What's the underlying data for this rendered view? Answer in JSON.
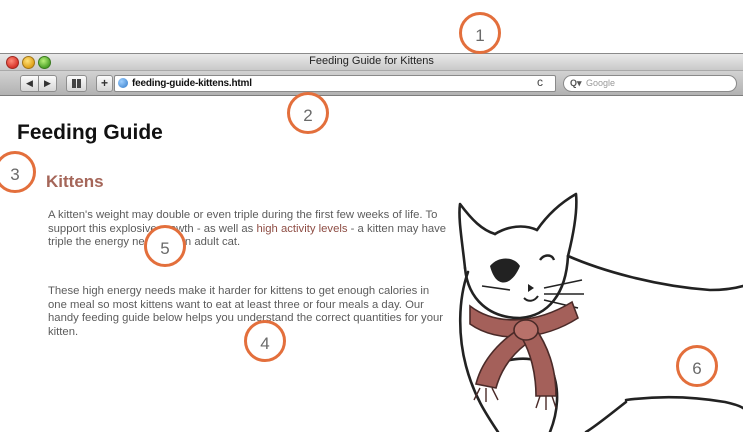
{
  "window": {
    "title": "Feeding Guide for Kittens"
  },
  "toolbar": {
    "address": "feeding-guide-kittens.html",
    "search_placeholder": "Google",
    "back_symbol": "◀",
    "forward_symbol": "▶",
    "add_symbol": "+",
    "reload_symbol": "c"
  },
  "page": {
    "heading": "Feeding Guide",
    "subheading": "Kittens",
    "paragraph1": {
      "before": "A kitten's weight may double or even triple during the first few weeks of life. To support this explosive growth - as well as ",
      "link": "high activity levels",
      "after": " - a kitten may have triple the energy needs of an adult cat."
    },
    "paragraph2": "These high energy needs make it harder for kittens to get enough calories in one meal so most kittens want to eat at least three or four meals a day. Our handy feeding guide below helps you understand the correct quantities for your kitten."
  },
  "callouts": [
    "1",
    "2",
    "3",
    "4",
    "5",
    "6"
  ],
  "colors": {
    "callout_ring": "#e36f3c",
    "subheading": "#a56659",
    "link": "#8e4d44"
  },
  "icons": [
    "close-icon",
    "minimize-icon",
    "zoom-icon",
    "back-icon",
    "forward-icon",
    "bookmarks-icon",
    "add-bookmark-icon",
    "globe-icon",
    "reload-icon",
    "search-icon",
    "cat-illustration"
  ]
}
